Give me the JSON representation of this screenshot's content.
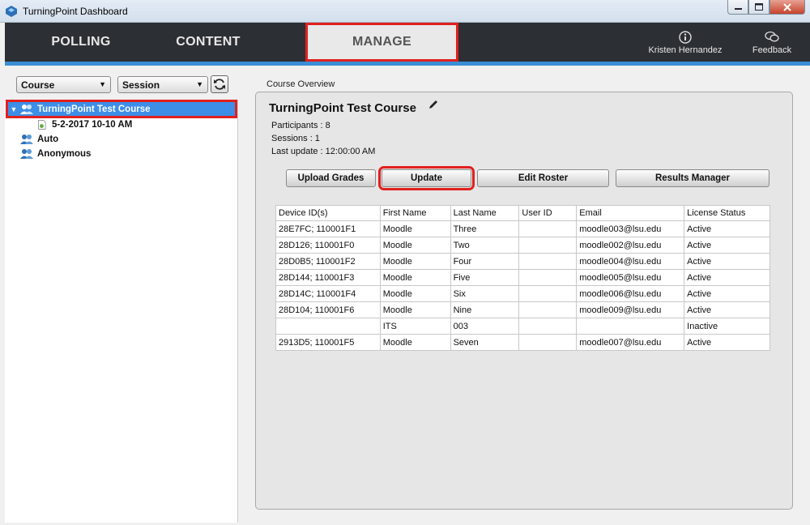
{
  "window": {
    "title": "TurningPoint Dashboard"
  },
  "nav": {
    "tabs": [
      {
        "label": "POLLING"
      },
      {
        "label": "CONTENT"
      },
      {
        "label": "MANAGE"
      }
    ],
    "user_name": "Kristen Hernandez",
    "feedback_label": "Feedback"
  },
  "left": {
    "course_select": "Course",
    "session_select": "Session",
    "tree": [
      {
        "label": "TurningPoint Test Course"
      },
      {
        "label": "5-2-2017 10-10 AM"
      },
      {
        "label": "Auto"
      },
      {
        "label": "Anonymous"
      }
    ]
  },
  "main": {
    "section_label": "Course Overview",
    "course_title": "TurningPoint Test Course",
    "participants": "Participants : 8",
    "sessions": "Sessions : 1",
    "last_update": "Last update : 12:00:00 AM",
    "buttons": {
      "upload_grades": "Upload Grades",
      "update": "Update",
      "edit_roster": "Edit Roster",
      "results_manager": "Results Manager"
    },
    "table": {
      "headers": [
        "Device ID(s)",
        "First Name",
        "Last Name",
        "User ID",
        "Email",
        "License Status"
      ],
      "rows": [
        [
          "28E7FC; 110001F1",
          "Moodle",
          "Three",
          "",
          "moodle003@lsu.edu",
          "Active"
        ],
        [
          "28D126; 110001F0",
          "Moodle",
          "Two",
          "",
          "moodle002@lsu.edu",
          "Active"
        ],
        [
          "28D0B5; 110001F2",
          "Moodle",
          "Four",
          "",
          "moodle004@lsu.edu",
          "Active"
        ],
        [
          "28D144; 110001F3",
          "Moodle",
          "Five",
          "",
          "moodle005@lsu.edu",
          "Active"
        ],
        [
          "28D14C; 110001F4",
          "Moodle",
          "Six",
          "",
          "moodle006@lsu.edu",
          "Active"
        ],
        [
          "28D104; 110001F6",
          "Moodle",
          "Nine",
          "",
          "moodle009@lsu.edu",
          "Active"
        ],
        [
          "",
          "ITS",
          "003",
          "",
          "",
          "Inactive"
        ],
        [
          "2913D5; 110001F5",
          "Moodle",
          "Seven",
          "",
          "moodle007@lsu.edu",
          "Active"
        ]
      ]
    }
  },
  "colors": {
    "nav_bg": "#2c2f33",
    "accent": "#3a8fd4",
    "highlight": "#e0201e",
    "selection": "#3d8ee6"
  }
}
